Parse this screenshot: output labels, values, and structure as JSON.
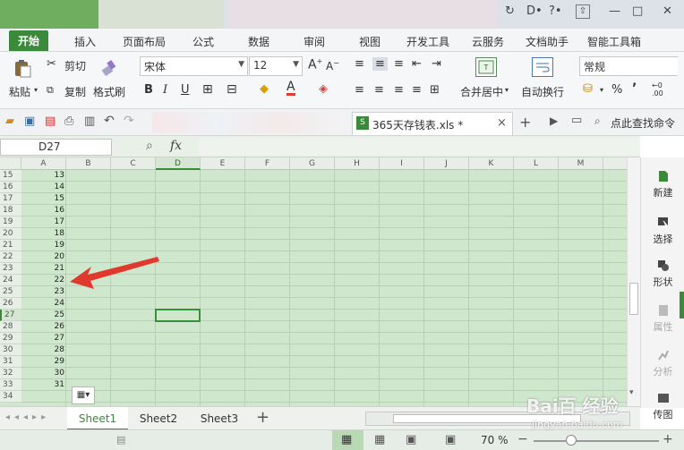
{
  "window": {
    "controls": [
      "↻",
      "D•",
      "?•",
      "—",
      "□",
      "✕"
    ]
  },
  "menu": {
    "tabs": [
      "开始",
      "插入",
      "页面布局",
      "公式",
      "数据",
      "审阅",
      "视图",
      "开发工具",
      "云服务",
      "文档助手",
      "智能工具箱"
    ],
    "active": "开始"
  },
  "ribbon": {
    "paste": "粘贴",
    "cut": "剪切",
    "copy": "复制",
    "format_painter": "格式刷",
    "font_name": "宋体",
    "font_size": "12",
    "bold": "B",
    "italic": "I",
    "underline": "U",
    "merge_center": "合并居中",
    "wrap_text": "自动换行",
    "number_format": "常规",
    "percent": "%",
    "comma": "’"
  },
  "doc": {
    "filename": "365天存钱表.xls *",
    "search": "点此查找命令"
  },
  "formula": {
    "cell_ref": "D27",
    "fx": "fx"
  },
  "grid": {
    "columns": [
      "A",
      "B",
      "C",
      "D",
      "E",
      "F",
      "G",
      "H",
      "I",
      "J",
      "K",
      "L",
      "M"
    ],
    "rows": [
      {
        "n": "15",
        "a": "13"
      },
      {
        "n": "16",
        "a": "14"
      },
      {
        "n": "17",
        "a": "15"
      },
      {
        "n": "18",
        "a": "16"
      },
      {
        "n": "19",
        "a": "17"
      },
      {
        "n": "20",
        "a": "18"
      },
      {
        "n": "21",
        "a": "19"
      },
      {
        "n": "22",
        "a": "20"
      },
      {
        "n": "23",
        "a": "21"
      },
      {
        "n": "24",
        "a": "22"
      },
      {
        "n": "25",
        "a": "23"
      },
      {
        "n": "26",
        "a": "24"
      },
      {
        "n": "27",
        "a": "25"
      },
      {
        "n": "28",
        "a": "26"
      },
      {
        "n": "29",
        "a": "27"
      },
      {
        "n": "30",
        "a": "28"
      },
      {
        "n": "31",
        "a": "29"
      },
      {
        "n": "32",
        "a": "30"
      },
      {
        "n": "33",
        "a": "31"
      },
      {
        "n": "34",
        "a": ""
      }
    ],
    "selected": "D27"
  },
  "sidebar": {
    "items": [
      "新建",
      "选择",
      "形状",
      "属性",
      "分析",
      "传图"
    ]
  },
  "sheets": {
    "tabs": [
      "Sheet1",
      "Sheet2",
      "Sheet3"
    ],
    "active": "Sheet1",
    "add": "+"
  },
  "status": {
    "zoom": "70 %",
    "watermark": "Bai百 经验",
    "watermark_url": "jingyan.baidu.com"
  },
  "colors": {
    "accent": "#3a8a3a",
    "grid_bg": "#cfe7cd",
    "arrow": "#e03a2f"
  }
}
